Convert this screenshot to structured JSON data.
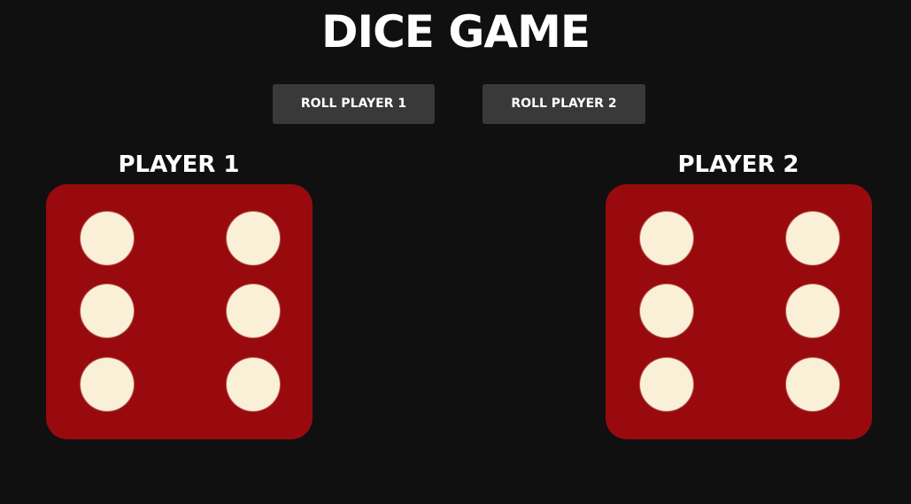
{
  "title": "DICE GAME",
  "buttons": {
    "roll_player_1": "ROLL PLAYER 1",
    "roll_player_2": "ROLL PLAYER 2"
  },
  "players": [
    {
      "label": "PLAYER 1",
      "die_value": 6
    },
    {
      "label": "PLAYER 2",
      "die_value": 6
    }
  ],
  "colors": {
    "background": "#101010",
    "button": "#393939",
    "die": "#990a0e",
    "pip": "#faefd7",
    "text": "#ffffff"
  }
}
